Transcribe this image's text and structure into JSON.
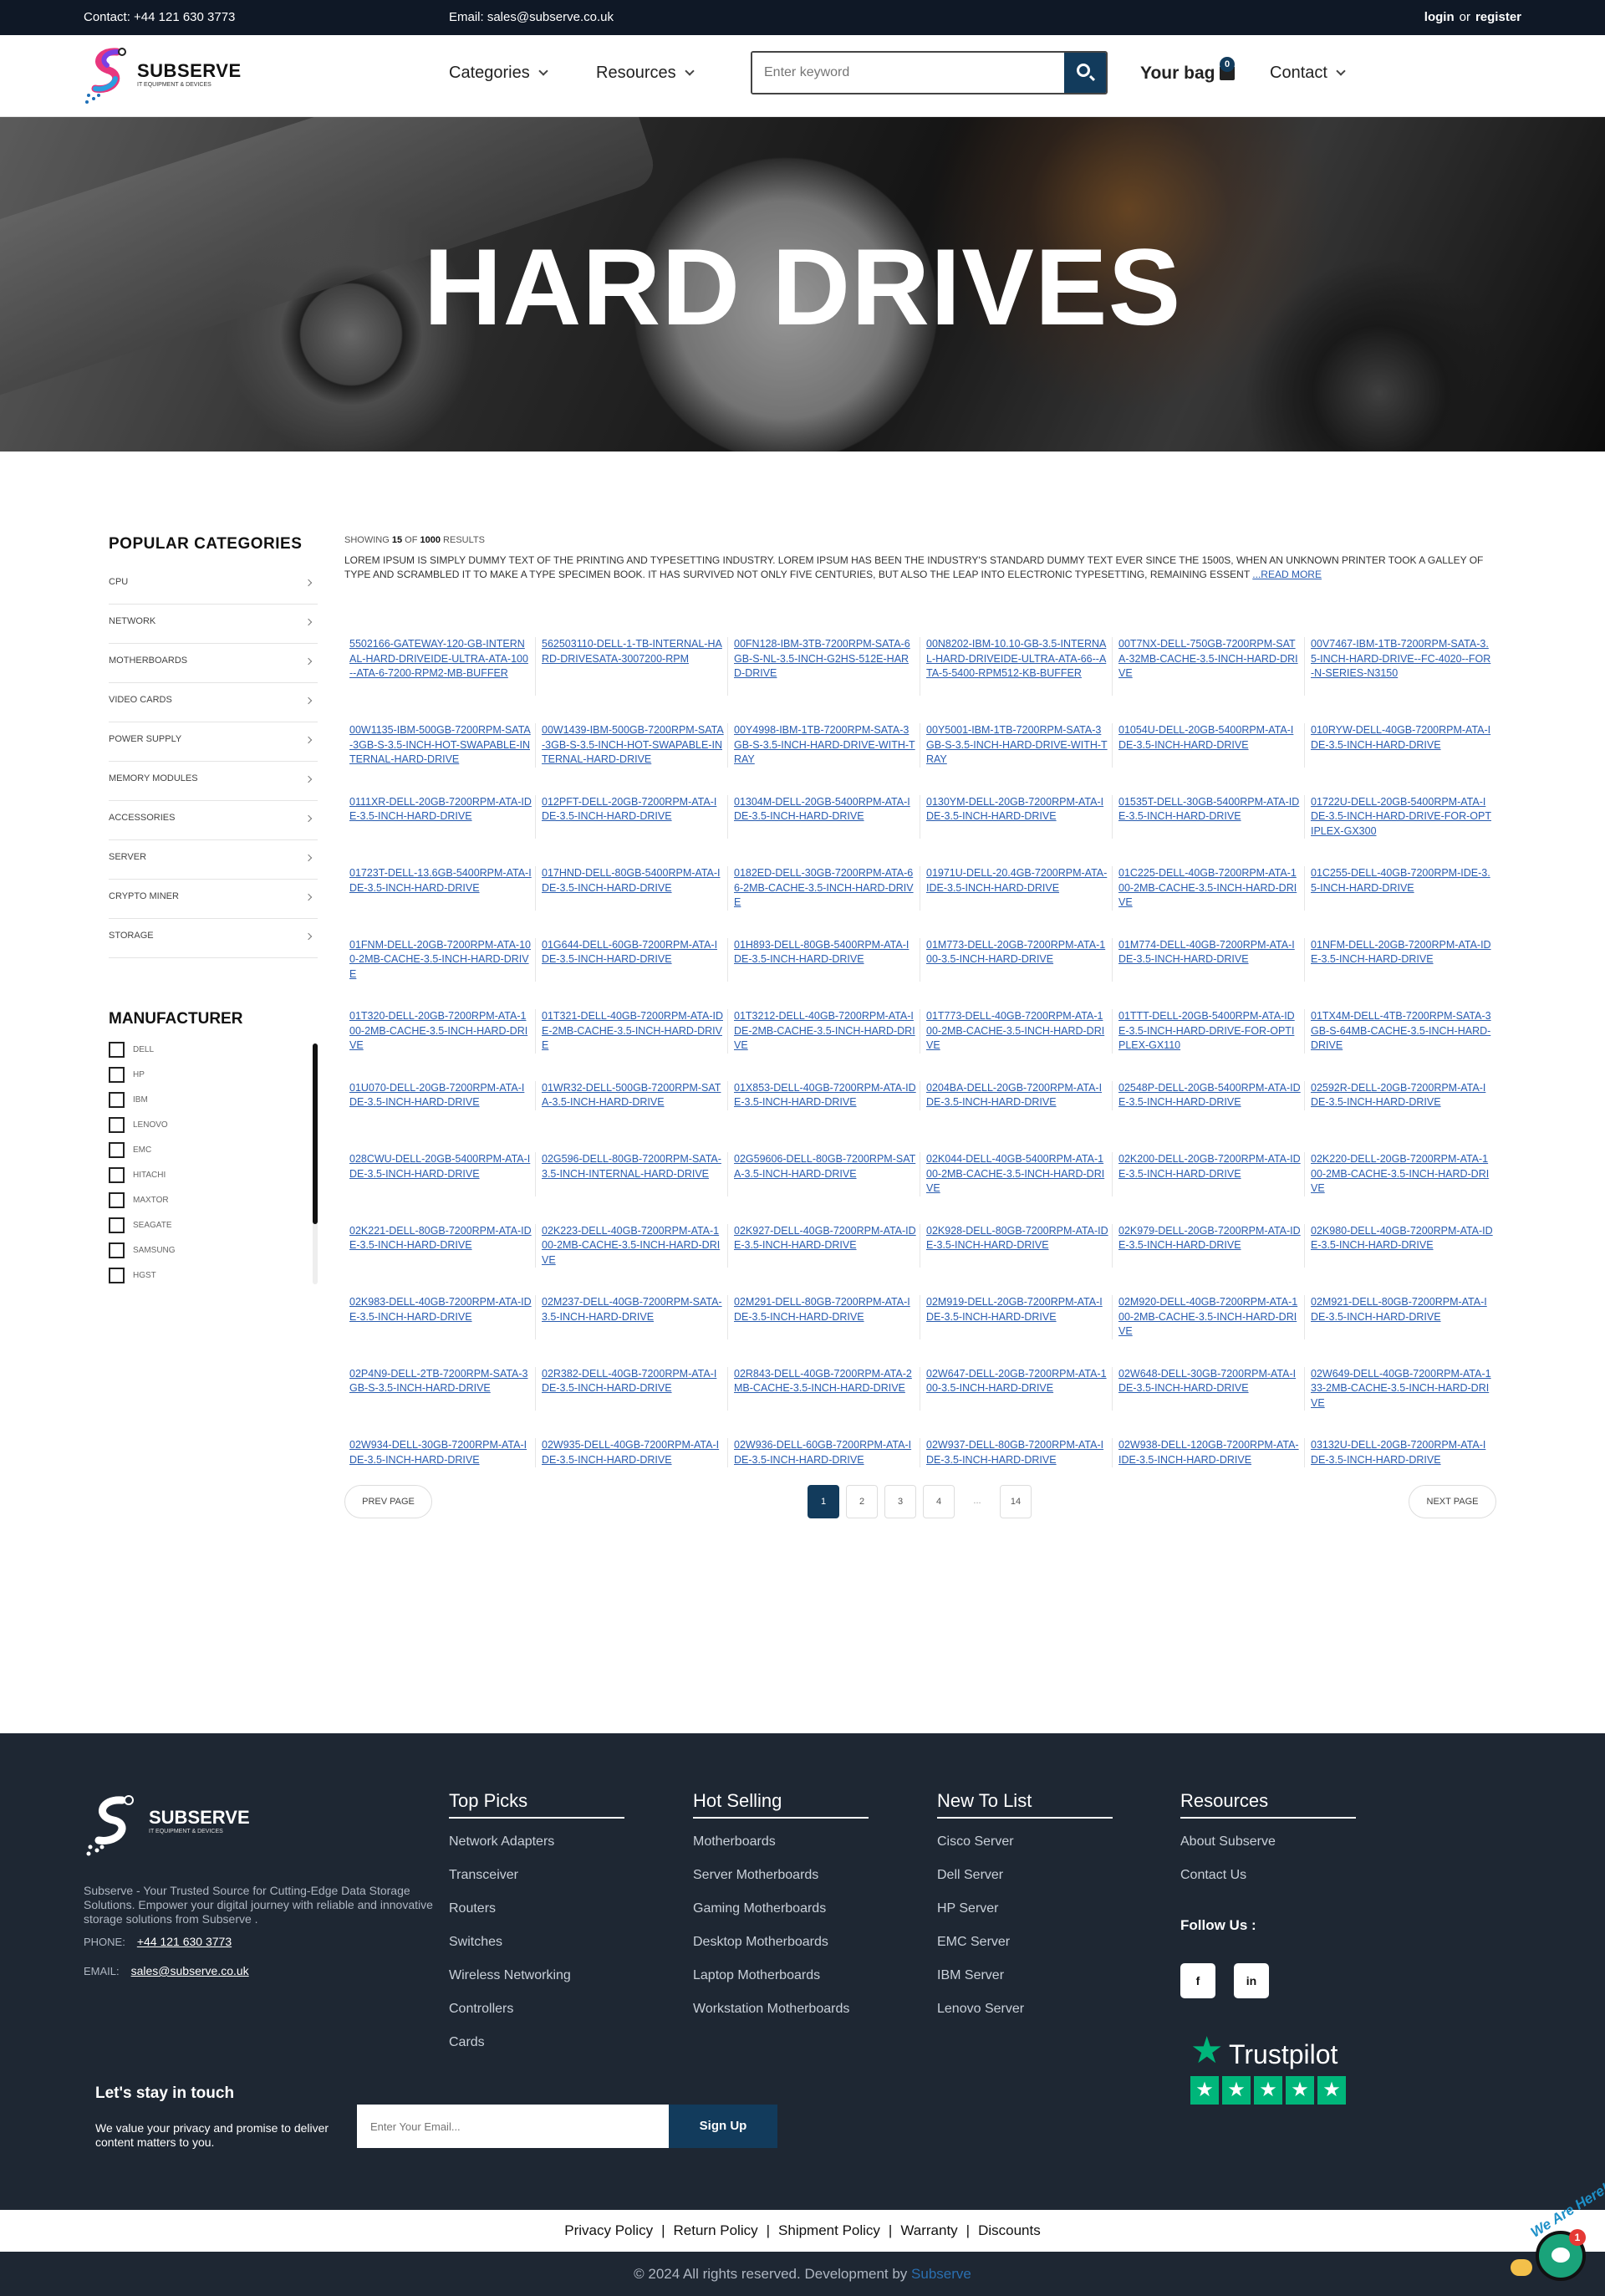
{
  "topbar": {
    "contact": "Contact: +44 121 630 3773",
    "email": "Email: sales@subserve.co.uk",
    "login": "login",
    "or": "or",
    "register": "register"
  },
  "header": {
    "brand": "SUBSERVE",
    "tagline": "IT EQUIPMENT & DEVICES",
    "nav": {
      "categories": "Categories",
      "resources": "Resources",
      "contact": "Contact"
    },
    "search_placeholder": "Enter keyword",
    "bag_label": "Your bag",
    "bag_count": "0"
  },
  "hero": {
    "title": "HARD DRIVES"
  },
  "sidebar": {
    "categories_title": "POPULAR CATEGORIES",
    "categories": [
      "CPU",
      "NETWORK",
      "MOTHERBOARDS",
      "VIDEO CARDS",
      "POWER SUPPLY",
      "MEMORY MODULES",
      "ACCESSORIES",
      "SERVER",
      "CRYPTO MINER",
      "STORAGE"
    ],
    "manufacturer_title": "MANUFACTURER",
    "manufacturers": [
      "DELL",
      "HP",
      "IBM",
      "LENOVO",
      "EMC",
      "HITACHI",
      "MAXTOR",
      "SEAGATE",
      "SAMSUNG",
      "HGST"
    ]
  },
  "results": {
    "showing_prefix": "SHOWING",
    "shown": "15",
    "of": "OF",
    "total": "1000",
    "suffix": "RESULTS",
    "description": "LOREM IPSUM IS SIMPLY DUMMY TEXT OF THE PRINTING AND TYPESETTING INDUSTRY. LOREM IPSUM HAS BEEN THE INDUSTRY'S STANDARD DUMMY TEXT EVER SINCE THE 1500S, WHEN AN UNKNOWN PRINTER TOOK A GALLEY OF TYPE AND SCRAMBLED IT TO MAKE A TYPE SPECIMEN BOOK. IT HAS SURVIVED NOT ONLY FIVE CENTURIES, BUT ALSO THE LEAP INTO ELECTRONIC TYPESETTING, REMAINING ESSENT",
    "read_more": "...READ MORE"
  },
  "products": [
    [
      "5502166-GATEWAY-120-GB-INTERNAL-HARD-DRIVEIDE-ULTRA-ATA-100--ATA-6-7200-RPM2-MB-BUFFER",
      "562503110-DELL-1-TB-INTERNAL-HARD-DRIVESATA-3007200-RPM",
      "00FN128-IBM-3TB-7200RPM-SATA-6GB-S-NL-3.5-INCH-G2HS-512E-HARD-DRIVE",
      "00N8202-IBM-10.10-GB-3.5-INTERNAL-HARD-DRIVEIDE-ULTRA-ATA-66--ATA-5-5400-RPM512-KB-BUFFER",
      "00T7NX-DELL-750GB-7200RPM-SATA-32MB-CACHE-3.5-INCH-HARD-DRIVE",
      "00V7467-IBM-1TB-7200RPM-SATA-3.5-INCH-HARD-DRIVE--FC-4020--FOR-N-SERIES-N3150"
    ],
    [
      "00W1135-IBM-500GB-7200RPM-SATA-3GB-S-3.5-INCH-HOT-SWAPABLE-INTERNAL-HARD-DRIVE",
      "00W1439-IBM-500GB-7200RPM-SATA-3GB-S-3.5-INCH-HOT-SWAPABLE-INTERNAL-HARD-DRIVE",
      "00Y4998-IBM-1TB-7200RPM-SATA-3GB-S-3.5-INCH-HARD-DRIVE-WITH-TRAY",
      "00Y5001-IBM-1TB-7200RPM-SATA-3GB-S-3.5-INCH-HARD-DRIVE-WITH-TRAY",
      "01054U-DELL-20GB-5400RPM-ATA-IDE-3.5-INCH-HARD-DRIVE",
      "010RYW-DELL-40GB-7200RPM-ATA-IDE-3.5-INCH-HARD-DRIVE"
    ],
    [
      "0111XR-DELL-20GB-7200RPM-ATA-IDE-3.5-INCH-HARD-DRIVE",
      "012PFT-DELL-20GB-7200RPM-ATA-IDE-3.5-INCH-HARD-DRIVE",
      "01304M-DELL-20GB-5400RPM-ATA-IDE-3.5-INCH-HARD-DRIVE",
      "0130YM-DELL-20GB-7200RPM-ATA-IDE-3.5-INCH-HARD-DRIVE",
      "01535T-DELL-30GB-5400RPM-ATA-IDE-3.5-INCH-HARD-DRIVE",
      "01722U-DELL-20GB-5400RPM-ATA-IDE-3.5-INCH-HARD-DRIVE-FOR-OPTIPLEX-GX300"
    ],
    [
      "01723T-DELL-13.6GB-5400RPM-ATA-IDE-3.5-INCH-HARD-DRIVE",
      "017HND-DELL-80GB-5400RPM-ATA-IDE-3.5-INCH-HARD-DRIVE",
      "0182ED-DELL-30GB-7200RPM-ATA-66-2MB-CACHE-3.5-INCH-HARD-DRIVE",
      "01971U-DELL-20.4GB-7200RPM-ATA-IDE-3.5-INCH-HARD-DRIVE",
      "01C225-DELL-40GB-7200RPM-ATA-100-2MB-CACHE-3.5-INCH-HARD-DRIVE",
      "01C255-DELL-40GB-7200RPM-IDE-3.5-INCH-HARD-DRIVE"
    ],
    [
      "01FNM-DELL-20GB-7200RPM-ATA-100-2MB-CACHE-3.5-INCH-HARD-DRIVE",
      "01G644-DELL-60GB-7200RPM-ATA-IDE-3.5-INCH-HARD-DRIVE",
      "01H893-DELL-80GB-5400RPM-ATA-IDE-3.5-INCH-HARD-DRIVE",
      "01M773-DELL-20GB-7200RPM-ATA-100-3.5-INCH-HARD-DRIVE",
      "01M774-DELL-40GB-7200RPM-ATA-IDE-3.5-INCH-HARD-DRIVE",
      "01NFM-DELL-20GB-7200RPM-ATA-IDE-3.5-INCH-HARD-DRIVE"
    ],
    [
      "01T320-DELL-20GB-7200RPM-ATA-100-2MB-CACHE-3.5-INCH-HARD-DRIVE",
      "01T321-DELL-40GB-7200RPM-ATA-IDE-2MB-CACHE-3.5-INCH-HARD-DRIVE",
      "01T3212-DELL-40GB-7200RPM-ATA-IDE-2MB-CACHE-3.5-INCH-HARD-DRIVE",
      "01T773-DELL-40GB-7200RPM-ATA-100-2MB-CACHE-3.5-INCH-HARD-DRIVE",
      "01TTT-DELL-20GB-5400RPM-ATA-IDE-3.5-INCH-HARD-DRIVE-FOR-OPTIPLEX-GX110",
      "01TX4M-DELL-4TB-7200RPM-SATA-3GB-S-64MB-CACHE-3.5-INCH-HARD-DRIVE"
    ],
    [
      "01U070-DELL-20GB-7200RPM-ATA-IDE-3.5-INCH-HARD-DRIVE",
      "01WR32-DELL-500GB-7200RPM-SATA-3.5-INCH-HARD-DRIVE",
      "01X853-DELL-40GB-7200RPM-ATA-IDE-3.5-INCH-HARD-DRIVE",
      "0204BA-DELL-20GB-7200RPM-ATA-IDE-3.5-INCH-HARD-DRIVE",
      "02548P-DELL-20GB-5400RPM-ATA-IDE-3.5-INCH-HARD-DRIVE",
      "02592R-DELL-20GB-7200RPM-ATA-IDE-3.5-INCH-HARD-DRIVE"
    ],
    [
      "028CWU-DELL-20GB-5400RPM-ATA-IDE-3.5-INCH-HARD-DRIVE",
      "02G596-DELL-80GB-7200RPM-SATA-3.5-INCH-INTERNAL-HARD-DRIVE",
      "02G59606-DELL-80GB-7200RPM-SATA-3.5-INCH-HARD-DRIVE",
      "02K044-DELL-40GB-5400RPM-ATA-100-2MB-CACHE-3.5-INCH-HARD-DRIVE",
      "02K200-DELL-20GB-7200RPM-ATA-IDE-3.5-INCH-HARD-DRIVE",
      "02K220-DELL-20GB-7200RPM-ATA-100-2MB-CACHE-3.5-INCH-HARD-DRIVE"
    ],
    [
      "02K221-DELL-80GB-7200RPM-ATA-IDE-3.5-INCH-HARD-DRIVE",
      "02K223-DELL-40GB-7200RPM-ATA-100-2MB-CACHE-3.5-INCH-HARD-DRIVE",
      "02K927-DELL-40GB-7200RPM-ATA-IDE-3.5-INCH-HARD-DRIVE",
      "02K928-DELL-80GB-7200RPM-ATA-IDE-3.5-INCH-HARD-DRIVE",
      "02K979-DELL-20GB-7200RPM-ATA-IDE-3.5-INCH-HARD-DRIVE",
      "02K980-DELL-40GB-7200RPM-ATA-IDE-3.5-INCH-HARD-DRIVE"
    ],
    [
      "02K983-DELL-40GB-7200RPM-ATA-IDE-3.5-INCH-HARD-DRIVE",
      "02M237-DELL-40GB-7200RPM-SATA-3.5-INCH-HARD-DRIVE",
      "02M291-DELL-80GB-7200RPM-ATA-IDE-3.5-INCH-HARD-DRIVE",
      "02M919-DELL-20GB-7200RPM-ATA-IDE-3.5-INCH-HARD-DRIVE",
      "02M920-DELL-40GB-7200RPM-ATA-100-2MB-CACHE-3.5-INCH-HARD-DRIVE",
      "02M921-DELL-80GB-7200RPM-ATA-IDE-3.5-INCH-HARD-DRIVE"
    ],
    [
      "02P4N9-DELL-2TB-7200RPM-SATA-3GB-S-3.5-INCH-HARD-DRIVE",
      "02R382-DELL-40GB-7200RPM-ATA-IDE-3.5-INCH-HARD-DRIVE",
      "02R843-DELL-40GB-7200RPM-ATA-2MB-CACHE-3.5-INCH-HARD-DRIVE",
      "02W647-DELL-20GB-7200RPM-ATA-100-3.5-INCH-HARD-DRIVE",
      "02W648-DELL-30GB-7200RPM-ATA-IDE-3.5-INCH-HARD-DRIVE",
      "02W649-DELL-40GB-7200RPM-ATA-133-2MB-CACHE-3.5-INCH-HARD-DRIVE"
    ],
    [
      "02W934-DELL-30GB-7200RPM-ATA-IDE-3.5-INCH-HARD-DRIVE",
      "02W935-DELL-40GB-7200RPM-ATA-IDE-3.5-INCH-HARD-DRIVE",
      "02W936-DELL-60GB-7200RPM-ATA-IDE-3.5-INCH-HARD-DRIVE",
      "02W937-DELL-80GB-7200RPM-ATA-IDE-3.5-INCH-HARD-DRIVE",
      "02W938-DELL-120GB-7200RPM-ATA-IDE-3.5-INCH-HARD-DRIVE",
      "03132U-DELL-20GB-7200RPM-ATA-IDE-3.5-INCH-HARD-DRIVE"
    ]
  ],
  "pagination": {
    "prev": "PREV PAGE",
    "next": "NEXT PAGE",
    "pages": [
      "1",
      "2",
      "3",
      "4",
      "...",
      "14"
    ],
    "current": "1"
  },
  "footer": {
    "brand": "SUBSERVE",
    "tagline": "IT EQUIPMENT & DEVICES",
    "description": "Subserve - Your Trusted Source for Cutting-Edge Data Storage Solutions. Empower your digital journey with reliable and innovative storage solutions from Subserve .",
    "phone_label": "PHONE:",
    "phone": "+44 121 630 3773",
    "email_label": "EMAIL:",
    "email": "sales@subserve.co.uk",
    "columns": [
      {
        "title": "Top Picks",
        "links": [
          "Network Adapters",
          "Transceiver",
          "Routers",
          "Switches",
          "Wireless Networking",
          "Controllers",
          "Cards"
        ]
      },
      {
        "title": "Hot Selling",
        "links": [
          "Motherboards",
          "Server Motherboards",
          "Gaming Motherboards",
          "Desktop Motherboards",
          "Laptop Motherboards",
          "Workstation Motherboards"
        ]
      },
      {
        "title": "New To List",
        "links": [
          "Cisco Server",
          "Dell Server",
          "HP Server",
          "EMC Server",
          "IBM Server",
          "Lenovo Server"
        ]
      },
      {
        "title": "Resources",
        "links": [
          "About Subserve",
          "Contact Us"
        ]
      }
    ],
    "follow_label": "Follow Us :",
    "social": {
      "facebook": "f",
      "linkedin": "in"
    },
    "trustpilot": "Trustpilot",
    "newsletter_title": "Let's stay in touch",
    "newsletter_sub": "We value your privacy and promise to deliver content matters to you.",
    "newsletter_placeholder": "Enter Your Email...",
    "newsletter_button": "Sign Up"
  },
  "policies": [
    "Privacy Policy",
    "Return Policy",
    "Shipment Policy",
    "Warranty",
    "Discounts"
  ],
  "copyright": {
    "text": "© 2024 All rights reserved. Development by",
    "developer": "Subserve"
  },
  "chat": {
    "tag": "We Are Here!",
    "badge": "1"
  },
  "colors": {
    "primary": "#123b5c",
    "topbar": "#0f1826",
    "footer": "#1e2733",
    "link": "#2a5db0",
    "trustpilot": "#00b67a"
  }
}
